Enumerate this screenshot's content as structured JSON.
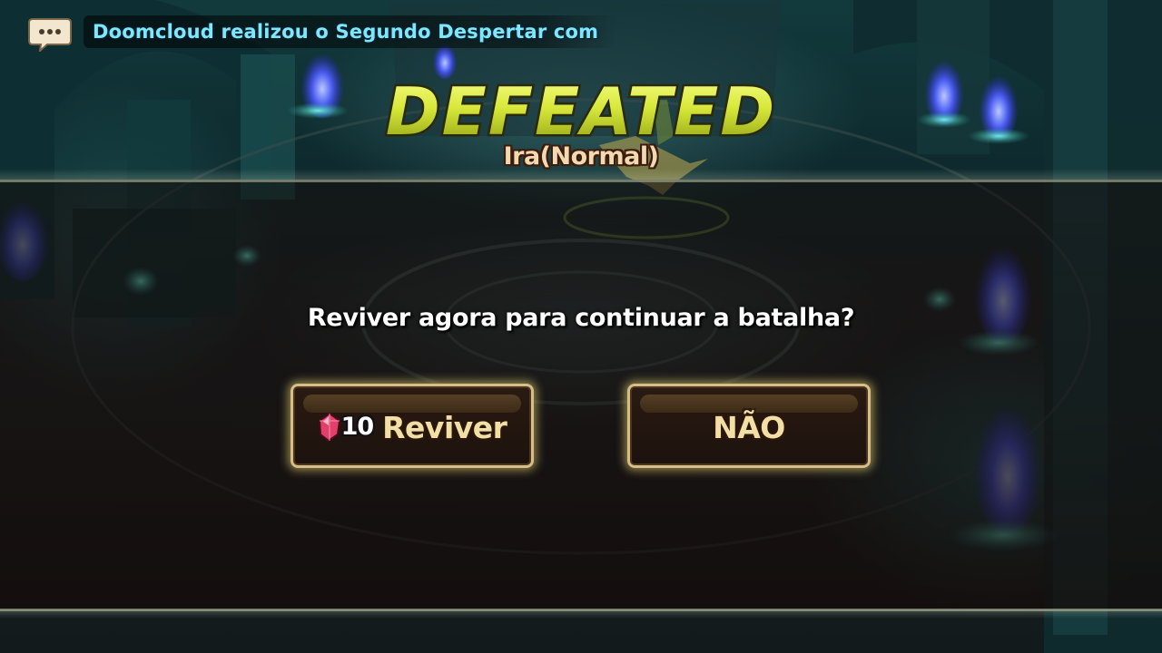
{
  "chat": {
    "message": "Doomcloud realizou o Segundo Despertar com",
    "icon": "speech-bubble-icon"
  },
  "result": {
    "title": "DEFEATED",
    "stage": "Ira(Normal)"
  },
  "dialog": {
    "prompt": "Reviver agora para continuar a batalha?",
    "revive_button": {
      "cost": "10",
      "currency_icon": "crystal-gem-icon",
      "label": "Reviver"
    },
    "no_button": {
      "label": "NÃO"
    }
  },
  "colors": {
    "title_fill": "#d8e83a",
    "chat_text": "#7fe6ff",
    "button_border": "#d7be86",
    "button_text": "#f2dfa6"
  }
}
